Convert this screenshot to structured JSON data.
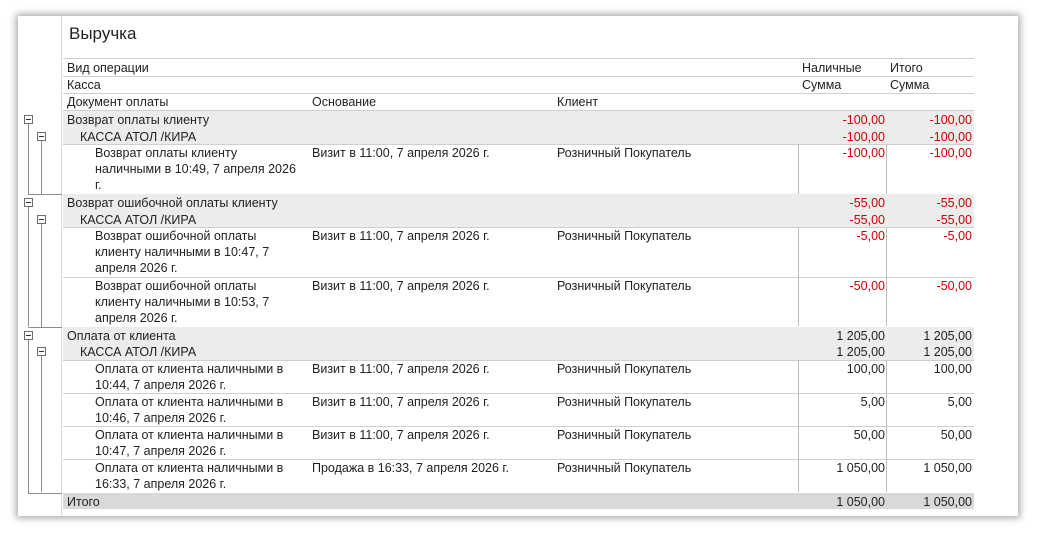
{
  "report": {
    "title": "Выручка",
    "header": {
      "row1": {
        "col1": "Вид операции",
        "nal": "Наличные",
        "itogo": "Итого"
      },
      "row2": {
        "col1": "Касса",
        "nal": "Сумма",
        "itogo": "Сумма"
      },
      "row3": {
        "doc": "Документ оплаты",
        "osn": "Основание",
        "client": "Клиент"
      }
    },
    "groups": [
      {
        "name": "Возврат оплаты клиенту",
        "nal": "-100,00",
        "itogo": "-100,00",
        "kassa": {
          "name": "КАССА АТОЛ /КИРА",
          "nal": "-100,00",
          "itogo": "-100,00"
        },
        "rows": [
          {
            "doc": "Возврат оплаты клиенту наличными в 10:49, 7 апреля 2026 г.",
            "osn": "Визит в 11:00, 7 апреля 2026 г.",
            "client": "Розничный Покупатель",
            "nal": "-100,00",
            "itogo": "-100,00"
          }
        ]
      },
      {
        "name": "Возврат ошибочной оплаты клиенту",
        "nal": "-55,00",
        "itogo": "-55,00",
        "kassa": {
          "name": "КАССА АТОЛ /КИРА",
          "nal": "-55,00",
          "itogo": "-55,00"
        },
        "rows": [
          {
            "doc": "Возврат ошибочной оплаты клиенту наличными в 10:47, 7 апреля 2026 г.",
            "osn": "Визит в 11:00, 7 апреля 2026 г.",
            "client": "Розничный Покупатель",
            "nal": "-5,00",
            "itogo": "-5,00"
          },
          {
            "doc": "Возврат ошибочной оплаты клиенту наличными в 10:53, 7 апреля 2026 г.",
            "osn": "Визит в 11:00, 7 апреля 2026 г.",
            "client": "Розничный Покупатель",
            "nal": "-50,00",
            "itogo": "-50,00"
          }
        ]
      },
      {
        "name": "Оплата от клиента",
        "nal": "1 205,00",
        "itogo": "1 205,00",
        "kassa": {
          "name": "КАССА АТОЛ /КИРА",
          "nal": "1 205,00",
          "itogo": "1 205,00"
        },
        "rows": [
          {
            "doc": "Оплата от клиента наличными в 10:44, 7 апреля 2026 г.",
            "osn": "Визит в 11:00, 7 апреля 2026 г.",
            "client": "Розничный Покупатель",
            "nal": "100,00",
            "itogo": "100,00"
          },
          {
            "doc": "Оплата от клиента наличными в 10:46, 7 апреля 2026 г.",
            "osn": "Визит в 11:00, 7 апреля 2026 г.",
            "client": "Розничный Покупатель",
            "nal": "5,00",
            "itogo": "5,00"
          },
          {
            "doc": "Оплата от клиента наличными в 10:47, 7 апреля 2026 г.",
            "osn": "Визит в 11:00, 7 апреля 2026 г.",
            "client": "Розничный Покупатель",
            "nal": "50,00",
            "itogo": "50,00"
          },
          {
            "doc": "Оплата от клиента наличными в 16:33, 7 апреля 2026 г.",
            "osn": "Продажа в 16:33, 7 апреля 2026 г.",
            "client": "Розничный Покупатель",
            "nal": "1 050,00",
            "itogo": "1 050,00"
          }
        ]
      }
    ],
    "total": {
      "label": "Итого",
      "nal": "1 050,00",
      "itogo": "1 050,00"
    },
    "colors": {
      "negative": "#cc0000",
      "group_band": "#ececec",
      "total_band": "#d9d9d9"
    },
    "icons": {
      "group_toggle": "collapse-minus-icon"
    }
  }
}
